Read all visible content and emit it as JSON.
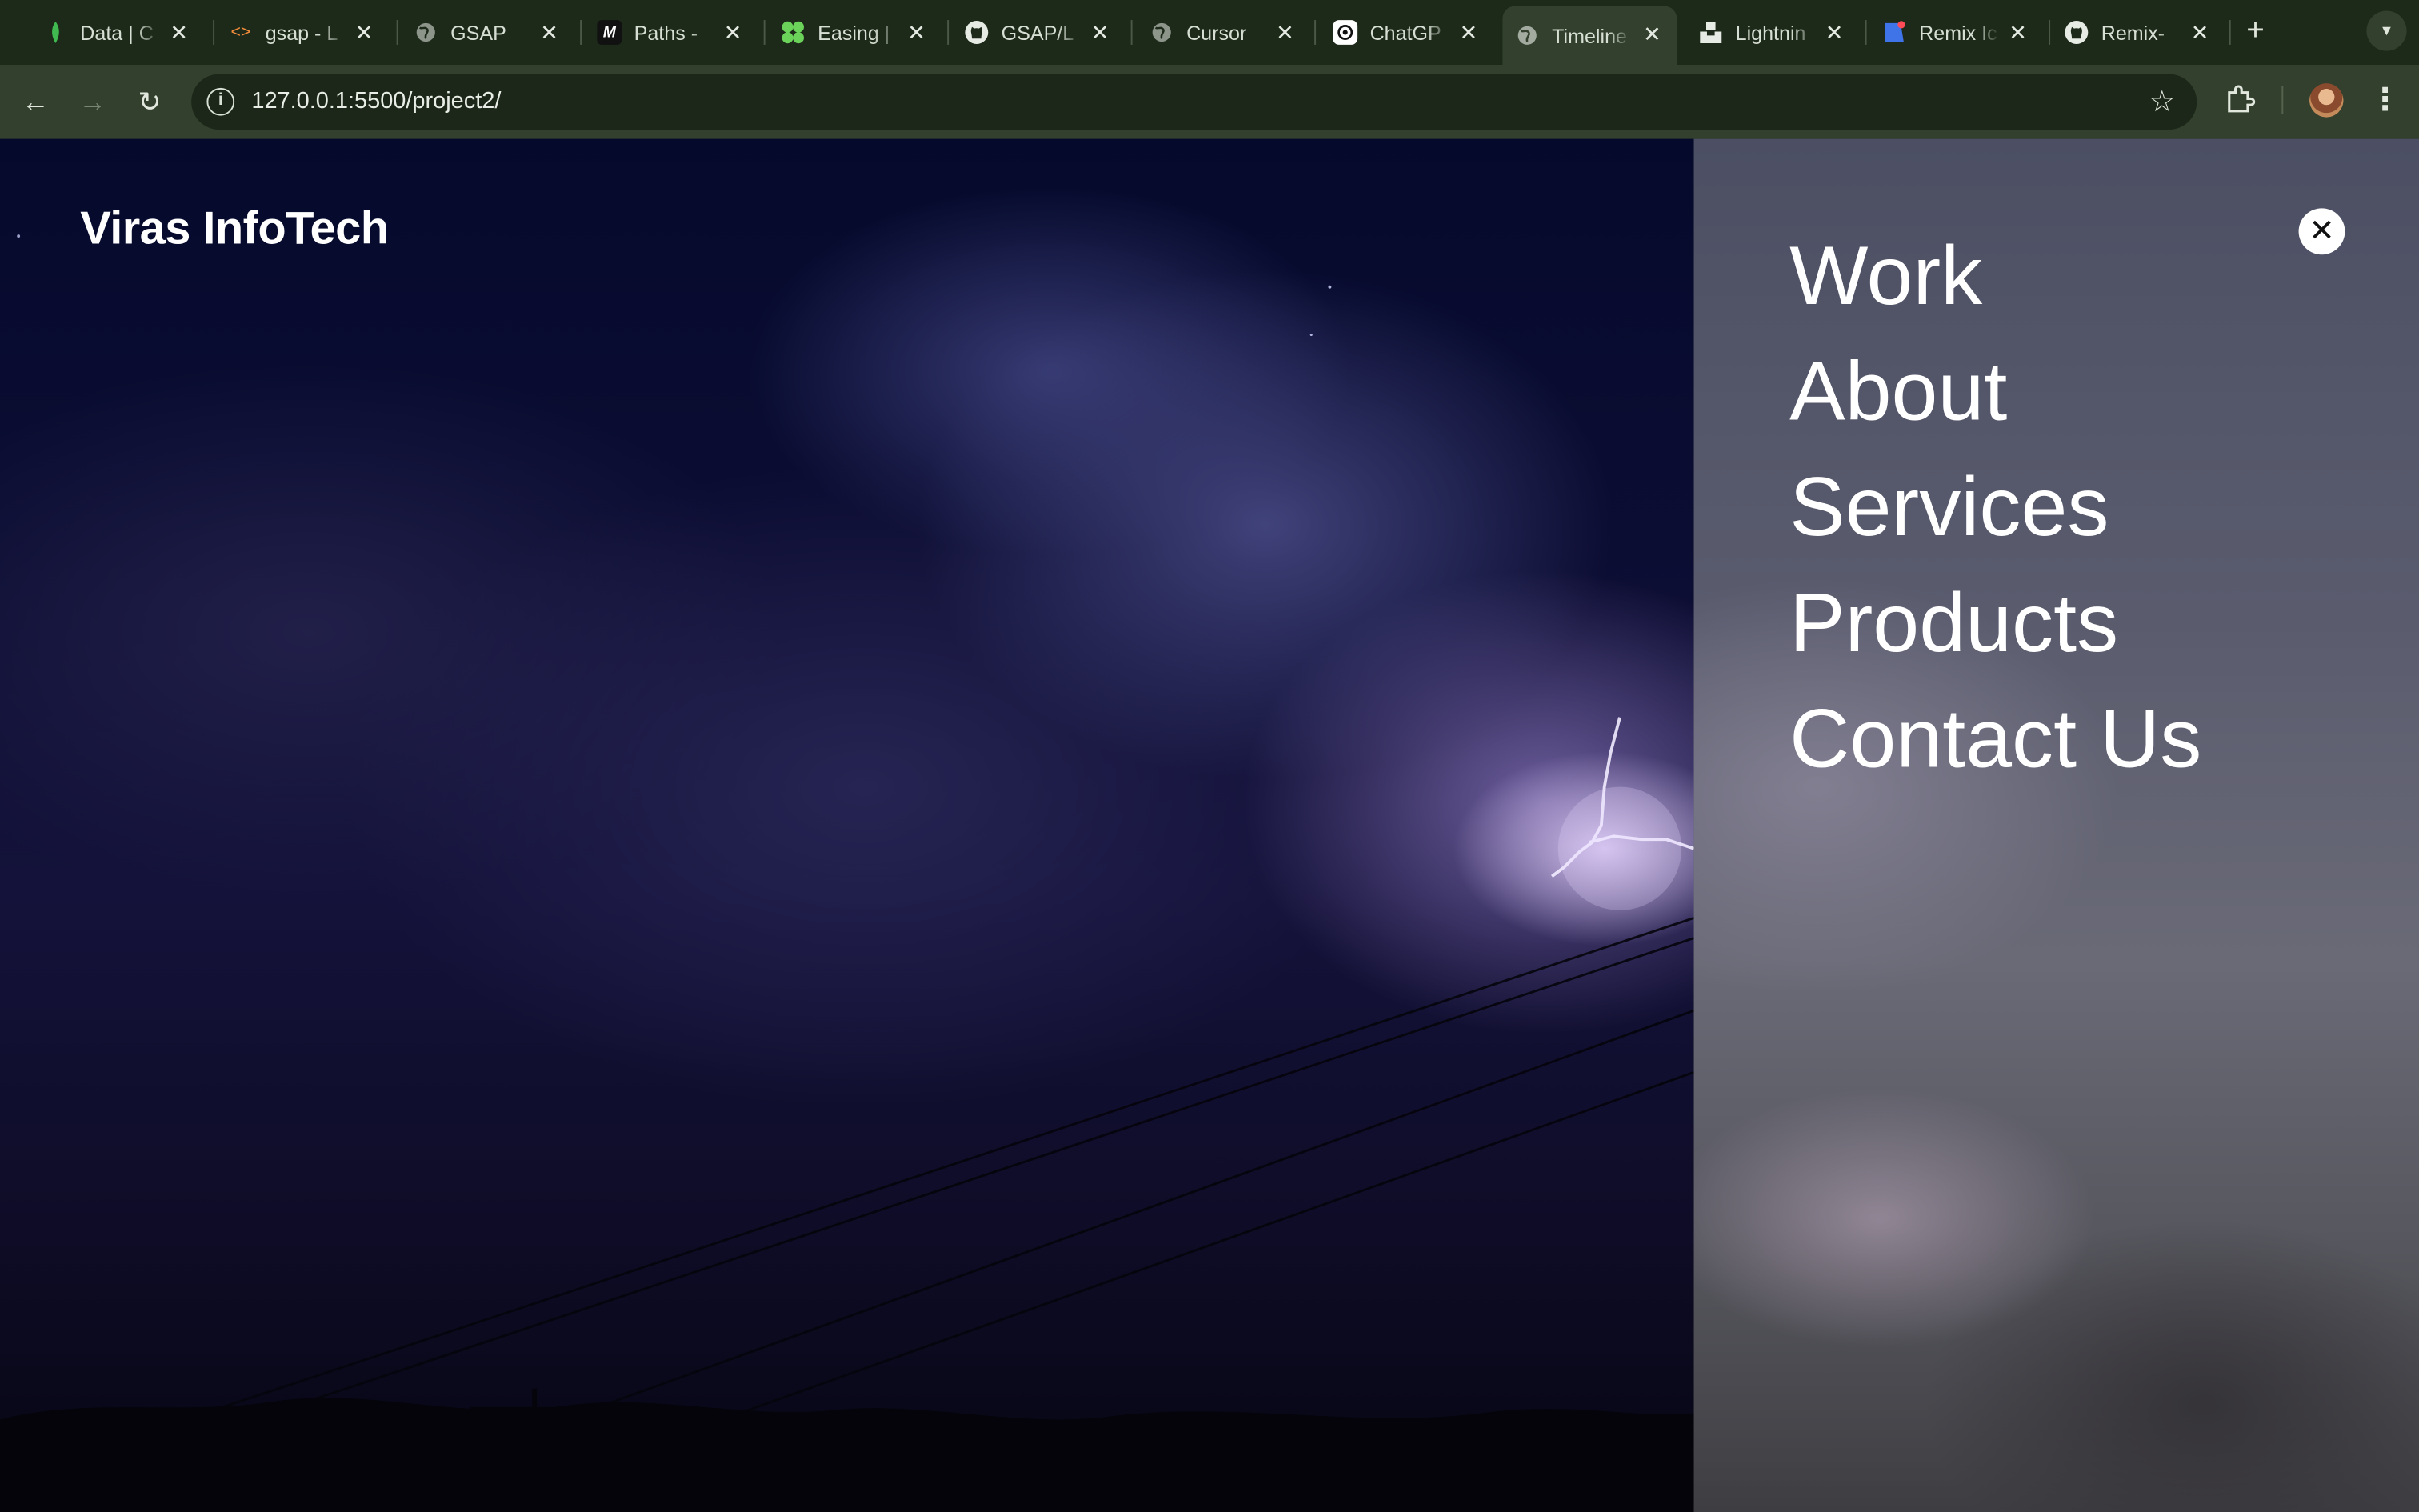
{
  "browser": {
    "tabs": [
      {
        "title": "Data | C",
        "icon": "mongodb-leaf-icon",
        "active": false
      },
      {
        "title": "gsap - L",
        "icon": "code-brackets-icon",
        "active": false
      },
      {
        "title": "GSAP",
        "icon": "globe-icon",
        "active": false
      },
      {
        "title": "Paths -",
        "icon": "m-logo-icon",
        "active": false
      },
      {
        "title": "Easing |",
        "icon": "green-clover-icon",
        "active": false
      },
      {
        "title": "GSAP/L",
        "icon": "github-icon",
        "active": false
      },
      {
        "title": "Cursor",
        "icon": "globe-icon",
        "active": false
      },
      {
        "title": "ChatGP",
        "icon": "chatgpt-icon",
        "active": false
      },
      {
        "title": "Timeline",
        "icon": "globe-icon",
        "active": true
      },
      {
        "title": "Lightnin",
        "icon": "unsplash-icon",
        "active": false
      },
      {
        "title": "Remix Ic",
        "icon": "remix-icon",
        "active": false
      },
      {
        "title": "Remix-",
        "icon": "github-icon",
        "active": false
      }
    ],
    "address_bar": {
      "url": "127.0.0.1:5500/project2/"
    }
  },
  "site": {
    "brand": "Viras InfoTech",
    "menu": {
      "items": [
        {
          "label": "Work"
        },
        {
          "label": "About"
        },
        {
          "label": "Services"
        },
        {
          "label": "Products"
        },
        {
          "label": "Contact Us"
        }
      ],
      "close_glyph": "✕"
    }
  },
  "colors": {
    "browser_frame": "#1d2a1a",
    "toolbar": "#32402d",
    "menu_text": "#ffffff",
    "hero_sky": "#0c0d33"
  }
}
